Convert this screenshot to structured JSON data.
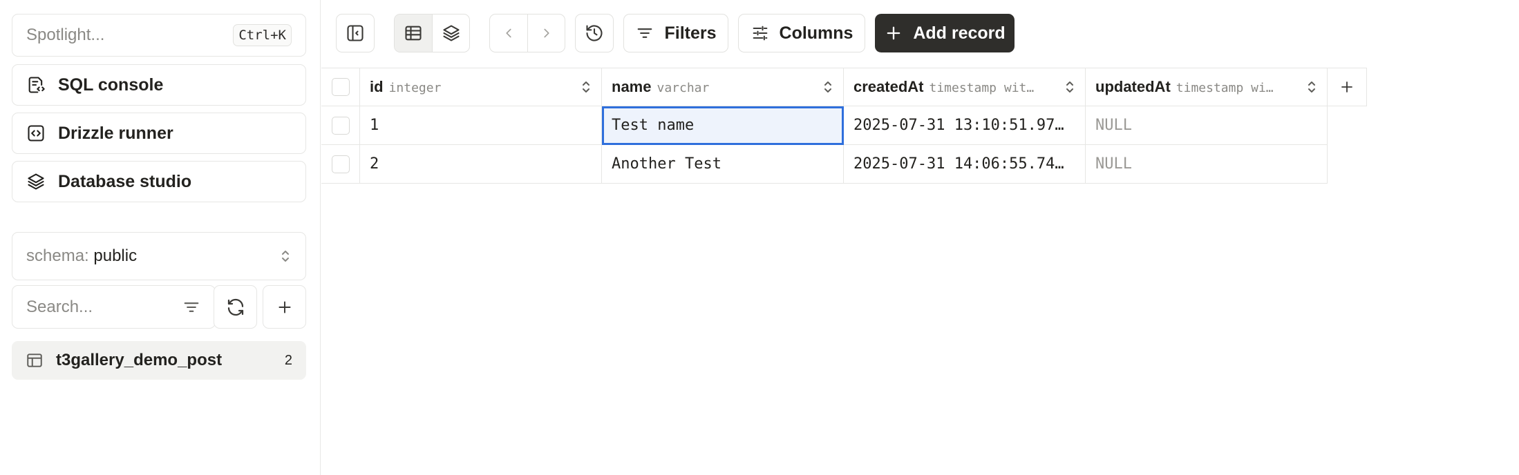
{
  "sidebar": {
    "spotlight": {
      "placeholder": "Spotlight...",
      "shortcut": "Ctrl+K"
    },
    "nav": [
      {
        "label": "SQL console",
        "icon": "sql-console-icon"
      },
      {
        "label": "Drizzle runner",
        "icon": "code-icon"
      },
      {
        "label": "Database studio",
        "icon": "layers-icon"
      }
    ],
    "schema": {
      "label": "schema:",
      "value": "public"
    },
    "search": {
      "placeholder": "Search..."
    },
    "tables": [
      {
        "name": "t3gallery_demo_post",
        "count": "2"
      }
    ]
  },
  "toolbar": {
    "filters_label": "Filters",
    "columns_label": "Columns",
    "add_record_label": "Add record"
  },
  "grid": {
    "columns": [
      {
        "name": "id",
        "type": "integer"
      },
      {
        "name": "name",
        "type": "varchar"
      },
      {
        "name": "createdAt",
        "type": "timestamp wit…"
      },
      {
        "name": "updatedAt",
        "type": "timestamp wi…"
      }
    ],
    "rows": [
      {
        "id": "1",
        "name": "Test name",
        "createdAt": "2025-07-31 13:10:51.97…",
        "updatedAt": "NULL"
      },
      {
        "id": "2",
        "name": "Another Test",
        "createdAt": "2025-07-31 14:06:55.74…",
        "updatedAt": "NULL"
      }
    ],
    "selected_cell": {
      "row": 0,
      "column": "name"
    }
  },
  "colors": {
    "primary": "#2f2e2b",
    "selection": "#2f6fdc",
    "selection_bg": "#eef3fc"
  }
}
